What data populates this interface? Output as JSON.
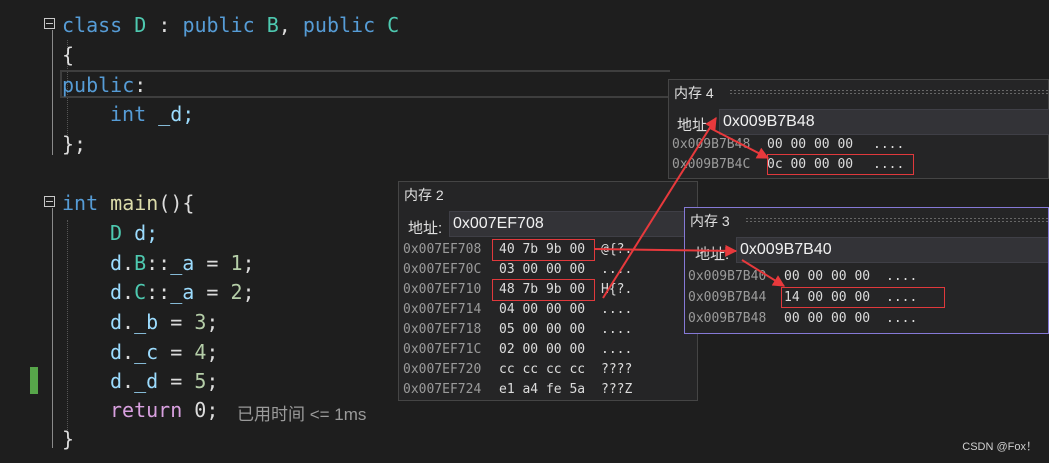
{
  "code": {
    "class_decl": {
      "kw_class": "class",
      "name": "D",
      "colon": " : ",
      "kw_public1": "public",
      "base1": "B",
      "comma": ", ",
      "kw_public2": "public",
      "base2": "C"
    },
    "open_brace": "{",
    "access": {
      "kw": "public",
      "colon": ":"
    },
    "member": {
      "type": "int",
      "name": " _d;"
    },
    "close_class": "};",
    "main_decl": {
      "ret_type": "int",
      "name": "main",
      "rest": "(){"
    },
    "body": {
      "l1": {
        "type": "D",
        "rest": " d;"
      },
      "l2": {
        "obj": "d",
        "dot": ".",
        "scope": "B",
        "rest": "::",
        "member": "_a",
        "eq": " = ",
        "num": "1",
        "semi": ";"
      },
      "l3": {
        "obj": "d",
        "dot": ".",
        "scope": "C",
        "rest": "::",
        "member": "_a",
        "eq": " = ",
        "num": "2",
        "semi": ";"
      },
      "l4": {
        "obj": "d",
        "dot": ".",
        "member": "_b",
        "eq": " = ",
        "num": "3",
        "semi": ";"
      },
      "l5": {
        "obj": "d",
        "dot": ".",
        "member": "_c",
        "eq": " = ",
        "num": "4",
        "semi": ";"
      },
      "l6": {
        "obj": "d",
        "dot": ".",
        "member": "_d",
        "eq": " = ",
        "num": "5",
        "semi": ";"
      },
      "l7": {
        "kw": "return",
        "rest": " 0;"
      }
    },
    "close_main": "}",
    "timing": "已用时间 <= 1ms"
  },
  "memory4": {
    "title": "内存 4",
    "address_label": "地址:",
    "address": "0x009B7B48",
    "rows": [
      {
        "addr": "0x009B7B48",
        "bytes": "00 00 00 00",
        "ascii": "...."
      },
      {
        "addr": "0x009B7B4C",
        "bytes": "0c 00 00 00",
        "ascii": "...."
      }
    ]
  },
  "memory2": {
    "title": "内存 2",
    "address_label": "地址:",
    "address": "0x007EF708",
    "rows": [
      {
        "addr": "0x007EF708",
        "bytes": "40 7b 9b 00",
        "ascii": "@{?."
      },
      {
        "addr": "0x007EF70C",
        "bytes": "03 00 00 00",
        "ascii": "...."
      },
      {
        "addr": "0x007EF710",
        "bytes": "48 7b 9b 00",
        "ascii": "H{?."
      },
      {
        "addr": "0x007EF714",
        "bytes": "04 00 00 00",
        "ascii": "...."
      },
      {
        "addr": "0x007EF718",
        "bytes": "05 00 00 00",
        "ascii": "...."
      },
      {
        "addr": "0x007EF71C",
        "bytes": "02 00 00 00",
        "ascii": "...."
      },
      {
        "addr": "0x007EF720",
        "bytes": "cc cc cc cc",
        "ascii": "????"
      },
      {
        "addr": "0x007EF724",
        "bytes": "e1 a4 fe 5a",
        "ascii": "???Z"
      }
    ]
  },
  "memory3": {
    "title": "内存 3",
    "address_label": "地址:",
    "address": "0x009B7B40",
    "rows": [
      {
        "addr": "0x009B7B40",
        "bytes": "00 00 00 00",
        "ascii": "...."
      },
      {
        "addr": "0x009B7B44",
        "bytes": "14 00 00 00",
        "ascii": "...."
      },
      {
        "addr": "0x009B7B48",
        "bytes": "00 00 00 00",
        "ascii": "...."
      }
    ]
  },
  "watermark": "CSDN @Fox！",
  "colors": {
    "arrow": "#e8393c",
    "highlight": "#e0393c",
    "panel_active": "#8579d6",
    "change_bar": "#57a64a"
  }
}
